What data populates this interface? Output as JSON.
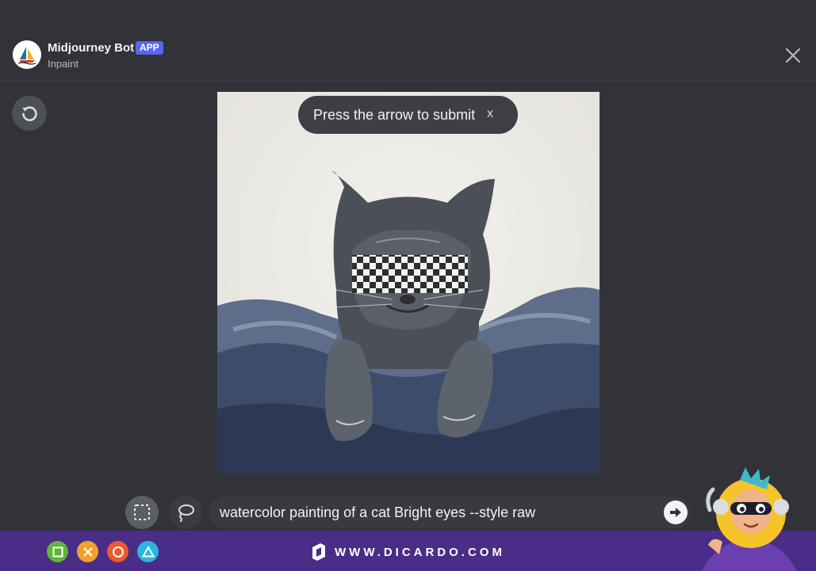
{
  "header": {
    "bot_name": "Midjourney Bot",
    "badge": "APP",
    "subtitle": "Inpaint",
    "close_icon": "close-icon"
  },
  "toolbar": {
    "undo_icon": "undo-icon"
  },
  "tooltip": {
    "text": "Press the arrow to submit",
    "dismiss": "x"
  },
  "canvas": {
    "image": "watercolor-cat-painting",
    "selection": "checkerboard-mask"
  },
  "tools": {
    "rect_select_icon": "rectangle-select-icon",
    "lasso_icon": "lasso-icon"
  },
  "prompt": {
    "value": "watercolor painting of a cat Bright eyes --style raw",
    "submit_icon": "arrow-right-icon"
  },
  "footer": {
    "buttons": [
      "square",
      "cross",
      "circle",
      "triangle"
    ],
    "colors": {
      "square": "#62b53b",
      "cross": "#f3a229",
      "circle": "#ee5a2e",
      "triangle": "#2cb5e0",
      "bar": "#4a2d86"
    },
    "brand": "WWW.DICARDO.COM"
  }
}
